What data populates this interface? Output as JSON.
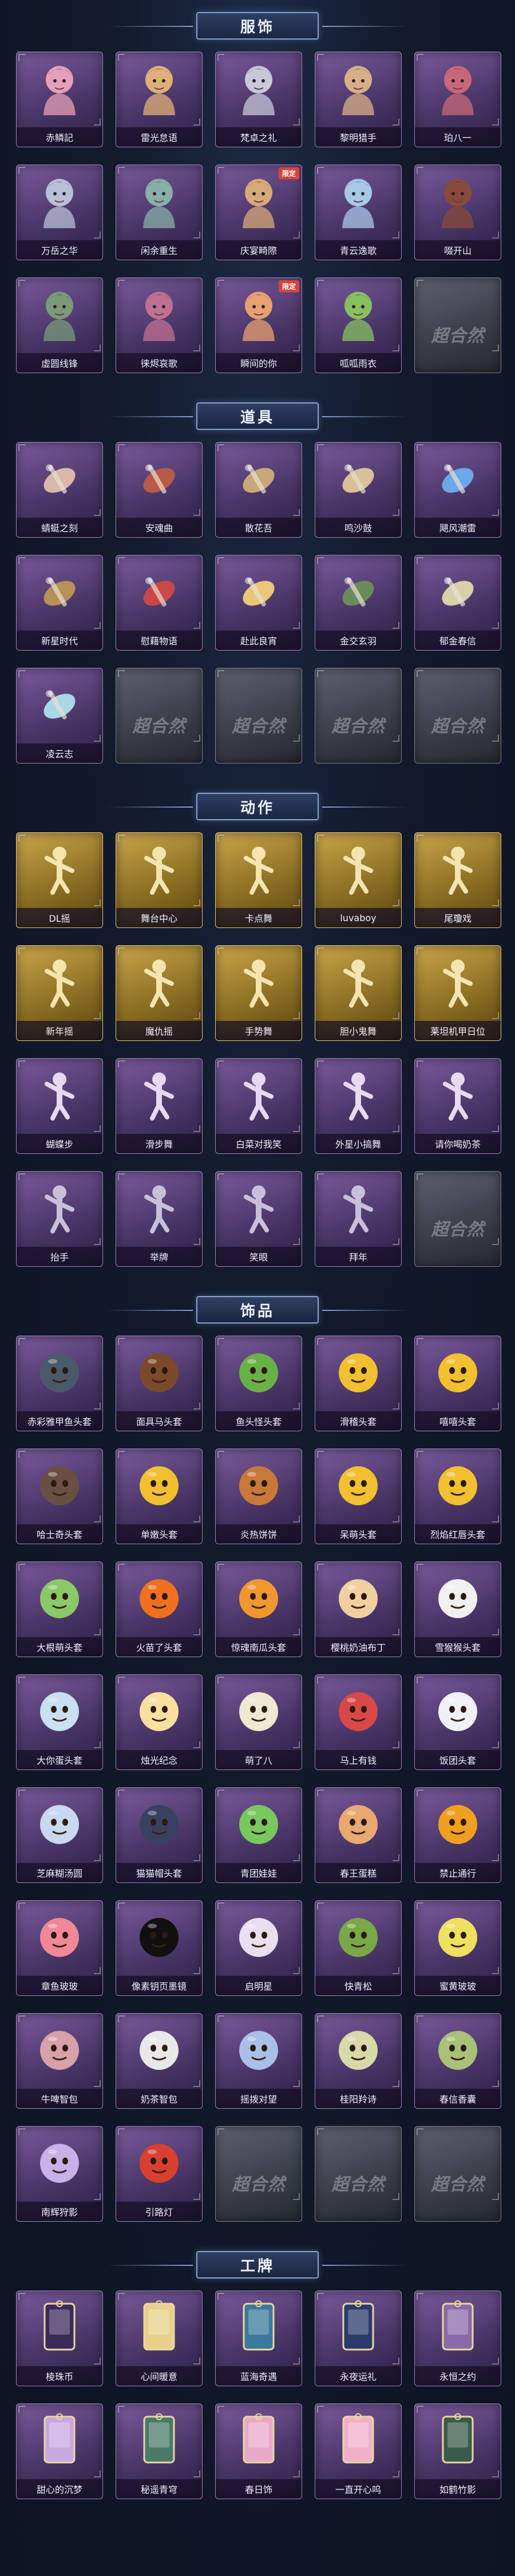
{
  "sections": [
    {
      "title": "服饰",
      "items": [
        {
          "label": "赤鳞記",
          "kind": "costume",
          "badge": "",
          "color": "#e6a0b8"
        },
        {
          "label": "雷光怠语",
          "kind": "costume",
          "badge": "",
          "color": "#e0b07a"
        },
        {
          "label": "梵卓之礼",
          "kind": "costume",
          "badge": "",
          "color": "#c8c8d8"
        },
        {
          "label": "黎明猎手",
          "kind": "costume",
          "badge": "",
          "color": "#d8b088"
        },
        {
          "label": "珀八一",
          "kind": "costume",
          "badge": "",
          "color": "#c86878"
        },
        {
          "label": "万岳之华",
          "kind": "costume",
          "badge": "",
          "color": "#b8c0d8"
        },
        {
          "label": "闲余重生",
          "kind": "costume",
          "badge": "",
          "color": "#88b0a8"
        },
        {
          "label": "庆宴畸際",
          "kind": "costume",
          "badge": "限定",
          "color": "#d8a878"
        },
        {
          "label": "青云逸歌",
          "kind": "costume",
          "badge": "",
          "color": "#a8c8e8"
        },
        {
          "label": "啜开山",
          "kind": "costume",
          "badge": "",
          "color": "#8a4a3a"
        },
        {
          "label": "虛圆线锋",
          "kind": "costume",
          "badge": "",
          "color": "#7a9a78"
        },
        {
          "label": "徕烬哀歌",
          "kind": "costume",
          "badge": "",
          "color": "#c07090"
        },
        {
          "label": "瞬间的你",
          "kind": "costume",
          "badge": "限定",
          "color": "#e8a070"
        },
        {
          "label": "呱呱雨衣",
          "kind": "costume",
          "badge": "",
          "color": "#88c060"
        },
        {
          "label": "",
          "kind": "empty",
          "badge": "",
          "color": ""
        }
      ]
    },
    {
      "title": "道具",
      "items": [
        {
          "label": "蜻蜓之刻",
          "kind": "prop",
          "badge": "",
          "color": "#d8b8a8"
        },
        {
          "label": "安魂曲",
          "kind": "prop",
          "badge": "",
          "color": "#b85a4a"
        },
        {
          "label": "散花吾",
          "kind": "prop",
          "badge": "",
          "color": "#c8a878"
        },
        {
          "label": "鸣沙鼓",
          "kind": "prop",
          "badge": "",
          "color": "#d8c098"
        },
        {
          "label": "飓风潮雷",
          "kind": "prop",
          "badge": "",
          "color": "#6aa8e8"
        },
        {
          "label": "新星时代",
          "kind": "prop",
          "badge": "",
          "color": "#b89058"
        },
        {
          "label": "慰藉物语",
          "kind": "prop",
          "badge": "",
          "color": "#c84848"
        },
        {
          "label": "赴此良宵",
          "kind": "prop",
          "badge": "",
          "color": "#e8c878"
        },
        {
          "label": "金交玄羽",
          "kind": "prop",
          "badge": "",
          "color": "#6a8a5a"
        },
        {
          "label": "郁金春信",
          "kind": "prop",
          "badge": "",
          "color": "#d8d0a8"
        },
        {
          "label": "凌云志",
          "kind": "prop",
          "badge": "",
          "color": "#a8d8e8"
        },
        {
          "label": "",
          "kind": "empty",
          "badge": "",
          "color": ""
        },
        {
          "label": "",
          "kind": "empty",
          "badge": "",
          "color": ""
        },
        {
          "label": "",
          "kind": "empty",
          "badge": "",
          "color": ""
        },
        {
          "label": "",
          "kind": "empty",
          "badge": "",
          "color": ""
        }
      ]
    },
    {
      "title": "动作",
      "items": [
        {
          "label": "DL摇",
          "kind": "emote-gold",
          "badge": "",
          "color": ""
        },
        {
          "label": "舞台中心",
          "kind": "emote-gold",
          "badge": "",
          "color": ""
        },
        {
          "label": "卡点舞",
          "kind": "emote-gold",
          "badge": "",
          "color": ""
        },
        {
          "label": "luvaboy",
          "kind": "emote-gold",
          "badge": "",
          "color": ""
        },
        {
          "label": "尾瓊戏",
          "kind": "emote-gold",
          "badge": "",
          "color": ""
        },
        {
          "label": "新年摇",
          "kind": "emote-gold",
          "badge": "",
          "color": ""
        },
        {
          "label": "魔仇摇",
          "kind": "emote-gold",
          "badge": "",
          "color": ""
        },
        {
          "label": "手势舞",
          "kind": "emote-gold",
          "badge": "",
          "color": ""
        },
        {
          "label": "胆小鬼舞",
          "kind": "emote-gold",
          "badge": "",
          "color": ""
        },
        {
          "label": "莱坦机甲日位",
          "kind": "emote-gold",
          "badge": "",
          "color": ""
        },
        {
          "label": "蝴蝶步",
          "kind": "emote",
          "badge": "",
          "color": ""
        },
        {
          "label": "滑步舞",
          "kind": "emote",
          "badge": "",
          "color": ""
        },
        {
          "label": "白菜对我笑",
          "kind": "emote",
          "badge": "",
          "color": ""
        },
        {
          "label": "外星小搞舞",
          "kind": "emote",
          "badge": "",
          "color": ""
        },
        {
          "label": "请你喝奶茶",
          "kind": "emote",
          "badge": "",
          "color": ""
        },
        {
          "label": "抬手",
          "kind": "emote-plain",
          "badge": "",
          "color": ""
        },
        {
          "label": "举牌",
          "kind": "emote-plain",
          "badge": "",
          "color": ""
        },
        {
          "label": "笑眼",
          "kind": "emote-plain",
          "badge": "",
          "color": ""
        },
        {
          "label": "拜年",
          "kind": "emote-plain",
          "badge": "",
          "color": ""
        },
        {
          "label": "",
          "kind": "empty",
          "badge": "",
          "color": ""
        }
      ]
    },
    {
      "title": "饰品",
      "items": [
        {
          "label": "赤彩雅甲鱼头套",
          "kind": "head",
          "badge": "",
          "color": "#4a5a6a"
        },
        {
          "label": "面具马头套",
          "kind": "head",
          "badge": "",
          "color": "#7a4a2a"
        },
        {
          "label": "鱼头怪头套",
          "kind": "head",
          "badge": "",
          "color": "#6ab048"
        },
        {
          "label": "滑稽头套",
          "kind": "head",
          "badge": "",
          "color": "#f0c030"
        },
        {
          "label": "嘻嘻头套",
          "kind": "head",
          "badge": "",
          "color": "#f0c030"
        },
        {
          "label": "哈士奇头套",
          "kind": "head",
          "badge": "",
          "color": "#6a5040"
        },
        {
          "label": "单嫩头套",
          "kind": "head",
          "badge": "",
          "color": "#f0c030"
        },
        {
          "label": "炎热饼饼",
          "kind": "head",
          "badge": "",
          "color": "#c87838"
        },
        {
          "label": "呆萌头套",
          "kind": "head",
          "badge": "",
          "color": "#f0c030"
        },
        {
          "label": "烈焰红唇头套",
          "kind": "head",
          "badge": "",
          "color": "#f0c030"
        },
        {
          "label": "大根萌头套",
          "kind": "head",
          "badge": "",
          "color": "#8ac868"
        },
        {
          "label": "火苗了头套",
          "kind": "head",
          "badge": "",
          "color": "#f07020"
        },
        {
          "label": "惊魂南瓜头套",
          "kind": "head",
          "badge": "",
          "color": "#f09830"
        },
        {
          "label": "樱桃奶油布丁",
          "kind": "head",
          "badge": "",
          "color": "#f0d0a0"
        },
        {
          "label": "雪猴猴头套",
          "kind": "head",
          "badge": "",
          "color": "#f0f0f0"
        },
        {
          "label": "大你蛋头套",
          "kind": "head",
          "badge": "",
          "color": "#c8e0f0"
        },
        {
          "label": "烛光纪念",
          "kind": "head",
          "badge": "",
          "color": "#f8e0a0"
        },
        {
          "label": "萌了八",
          "kind": "head",
          "badge": "",
          "color": "#f0e8d0"
        },
        {
          "label": "马上有钱",
          "kind": "head",
          "badge": "",
          "color": "#d84848"
        },
        {
          "label": "饭团头套",
          "kind": "head",
          "badge": "",
          "color": "#f0f0f8"
        },
        {
          "label": "芝麻糊汤圆",
          "kind": "head",
          "badge": "",
          "color": "#c8d8f0"
        },
        {
          "label": "猫猫帽头套",
          "kind": "head",
          "badge": "",
          "color": "#3a4060"
        },
        {
          "label": "青团娃娃",
          "kind": "head",
          "badge": "",
          "color": "#78c860"
        },
        {
          "label": "春王蛋糕",
          "kind": "head",
          "badge": "",
          "color": "#e8a870"
        },
        {
          "label": "禁止通行",
          "kind": "head",
          "badge": "",
          "color": "#f0a020"
        },
        {
          "label": "章鱼玻玻",
          "kind": "head",
          "badge": "",
          "color": "#f08898"
        },
        {
          "label": "像素钥页墨镜",
          "kind": "head",
          "badge": "",
          "color": "#101010"
        },
        {
          "label": "启明星",
          "kind": "head",
          "badge": "",
          "color": "#e8e0f0"
        },
        {
          "label": "快青松",
          "kind": "head",
          "badge": "",
          "color": "#78a848"
        },
        {
          "label": "蜜黄玻玻",
          "kind": "head",
          "badge": "",
          "color": "#f0e060"
        },
        {
          "label": "牛啤智包",
          "kind": "head",
          "badge": "",
          "color": "#d8a0a8"
        },
        {
          "label": "奶茶智包",
          "kind": "head",
          "badge": "",
          "color": "#e8e8e8"
        },
        {
          "label": "摇拨对望",
          "kind": "head",
          "badge": "",
          "color": "#a8c0e8"
        },
        {
          "label": "桂阳羚诗",
          "kind": "head",
          "badge": "",
          "color": "#d8d8a8"
        },
        {
          "label": "春信香囊",
          "kind": "head",
          "badge": "",
          "color": "#a8c078"
        },
        {
          "label": "南辉狩影",
          "kind": "head",
          "badge": "",
          "color": "#c8b0e8"
        },
        {
          "label": "引路灯",
          "kind": "head",
          "badge": "",
          "color": "#d84030"
        },
        {
          "label": "",
          "kind": "empty",
          "badge": "",
          "color": ""
        },
        {
          "label": "",
          "kind": "empty",
          "badge": "",
          "color": ""
        },
        {
          "label": "",
          "kind": "empty",
          "badge": "",
          "color": ""
        }
      ]
    },
    {
      "title": "工牌",
      "items": [
        {
          "label": "棱珠币",
          "kind": "card",
          "badge": "",
          "color": "#3a2a5a"
        },
        {
          "label": "心间暖意",
          "kind": "card",
          "badge": "",
          "color": "#e8d088"
        },
        {
          "label": "蓝海奇遇",
          "kind": "card",
          "badge": "",
          "color": "#3a7a9a"
        },
        {
          "label": "永夜运礼",
          "kind": "card",
          "badge": "",
          "color": "#2a3a6a"
        },
        {
          "label": "永恒之约",
          "kind": "card",
          "badge": "",
          "color": "#8a6aa8"
        },
        {
          "label": "甜心的沉梦",
          "kind": "card",
          "badge": "",
          "color": "#c8a8e0"
        },
        {
          "label": "秘遥青穹",
          "kind": "card",
          "badge": "",
          "color": "#4a7a6a"
        },
        {
          "label": "春日饰",
          "kind": "card",
          "badge": "",
          "color": "#e8a8c8"
        },
        {
          "label": "一直开心呜",
          "kind": "card",
          "badge": "",
          "color": "#f0b0c8"
        },
        {
          "label": "如鹤竹影",
          "kind": "card",
          "badge": "",
          "color": "#3a5a4a"
        }
      ]
    }
  ],
  "empty_watermark": "超合然"
}
